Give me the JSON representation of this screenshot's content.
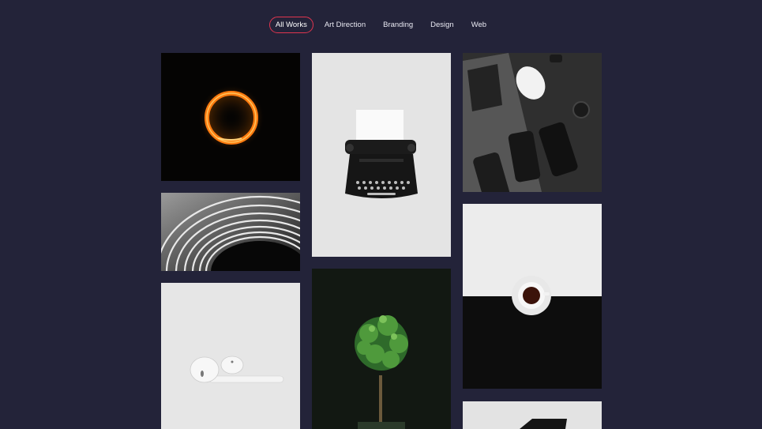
{
  "filters": [
    {
      "label": "All Works",
      "active": true
    },
    {
      "label": "Art Direction",
      "active": false
    },
    {
      "label": "Branding",
      "active": false
    },
    {
      "label": "Design",
      "active": false
    },
    {
      "label": "Web",
      "active": false
    }
  ],
  "gallery": [
    {
      "name": "fire-ring-photo"
    },
    {
      "name": "spiral-architecture-photo"
    },
    {
      "name": "earbuds-photo"
    },
    {
      "name": "typewriter-photo"
    },
    {
      "name": "plant-photo"
    },
    {
      "name": "laptop-phones-photo"
    },
    {
      "name": "coffee-cup-photo"
    },
    {
      "name": "dark-object-photo"
    }
  ],
  "colors": {
    "background": "#232339",
    "accent": "#e0354f"
  }
}
